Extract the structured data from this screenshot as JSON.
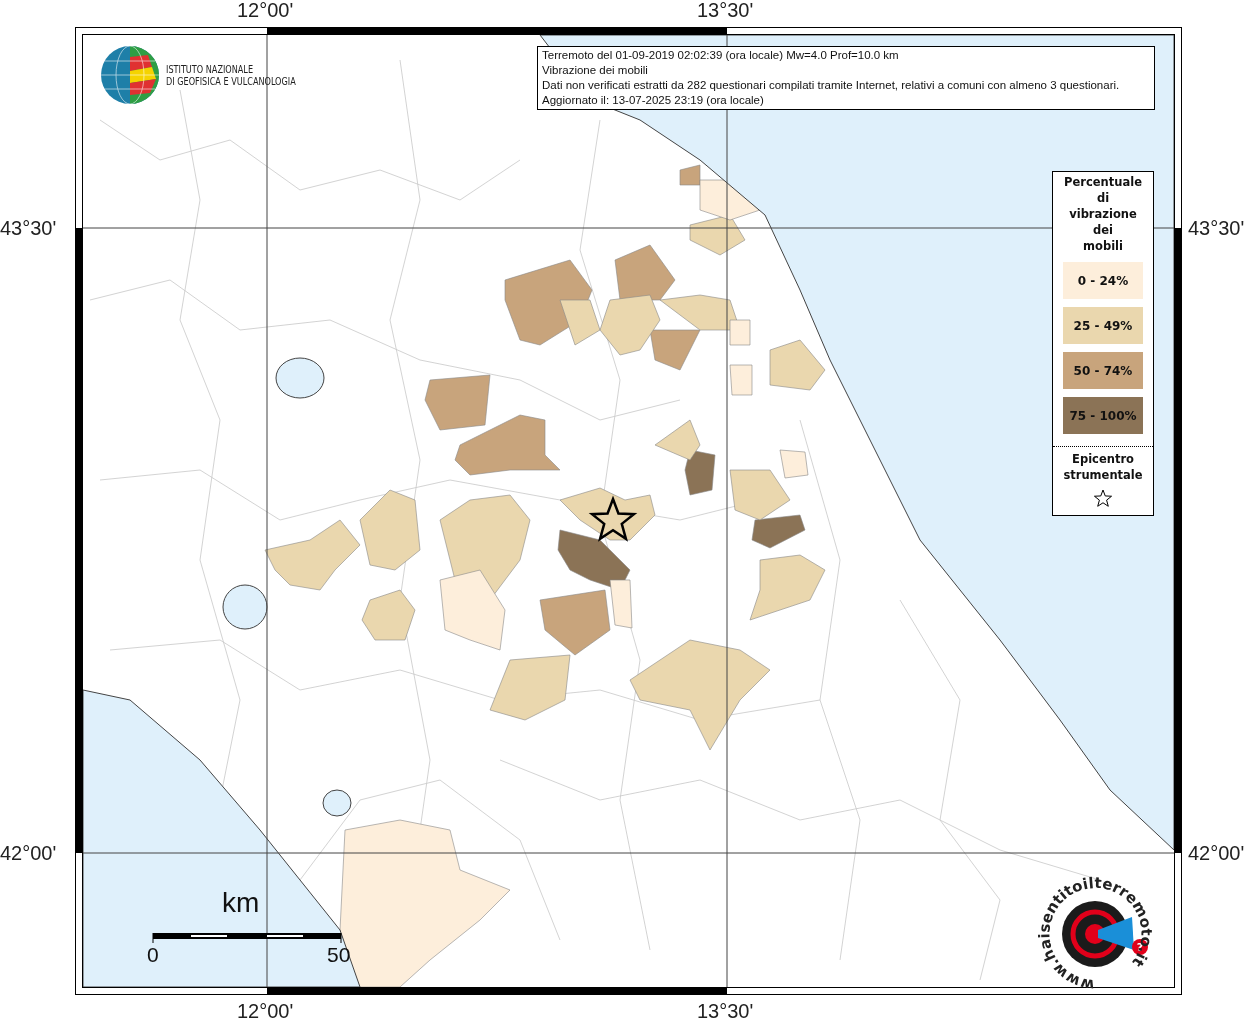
{
  "map": {
    "top_labels": [
      "12°00'",
      "13°30'"
    ],
    "bottom_labels": [
      "12°00'",
      "13°30'"
    ],
    "left_labels": [
      "43°30'",
      "42°00'"
    ],
    "right_labels": [
      "43°30'",
      "42°00'"
    ]
  },
  "institute_logo": {
    "lines": [
      "ISTITUTO NAZIONALE",
      "DI GEOFISICA E VULCANOLOGIA"
    ]
  },
  "info_box": {
    "lines": [
      "Terremoto del 01-09-2019 02:02:39 (ora locale) Mw=4.0 Prof=10.0 km",
      "Vibrazione dei mobili",
      "Dati non verificati estratti da 282 questionari compilati tramite Internet, relativi a comuni con almeno 3 questionari.",
      "Aggiornato il: 13-07-2025 23:19 (ora locale)"
    ]
  },
  "legend": {
    "title_lines": [
      "Percentuale",
      "di",
      "vibrazione",
      "dei",
      "mobili"
    ],
    "classes": [
      {
        "label": "0 - 24%",
        "color": "#fdeedb"
      },
      {
        "label": "25 - 49%",
        "color": "#ead7ae"
      },
      {
        "label": "50 - 74%",
        "color": "#c8a47c"
      },
      {
        "label": "75 - 100%",
        "color": "#8b7356"
      }
    ],
    "epicenter_lines": [
      "Epicentro",
      "strumentale"
    ]
  },
  "scale_bar": {
    "unit": "km",
    "ticks": [
      "0",
      "50"
    ]
  },
  "survey_logo": {
    "text": "www.haisentitoilterremoto.it",
    "badge": "?"
  }
}
